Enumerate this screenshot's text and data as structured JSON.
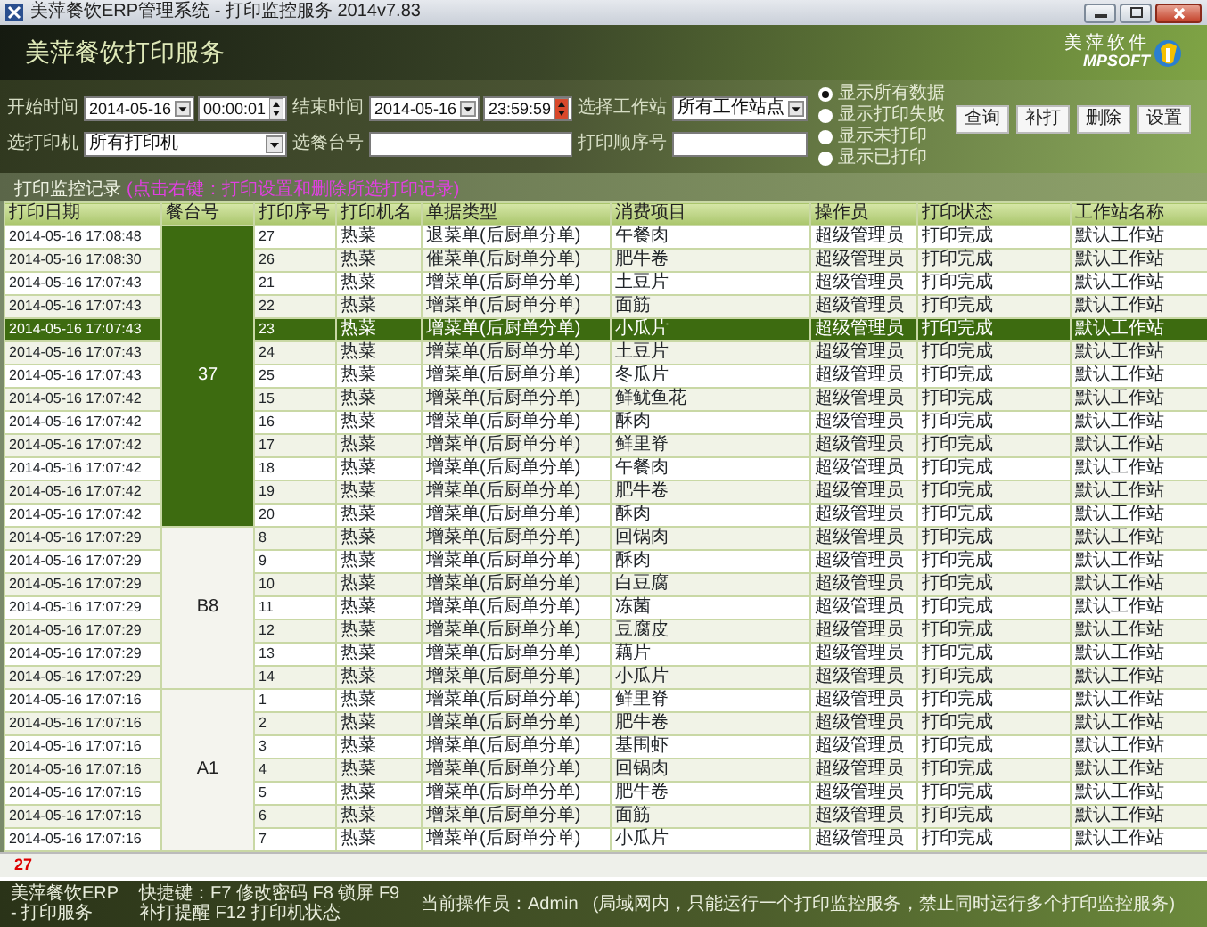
{
  "window": {
    "title": "美萍餐饮ERP管理系统 - 打印监控服务 2014v7.83"
  },
  "banner": {
    "title": "美萍餐饮打印服务",
    "logo_text": "美萍软件",
    "logo_subtext": "MPSOFT"
  },
  "filters": {
    "start_label": "开始时间",
    "start_date": "2014-05-16",
    "start_time": "00:00:01",
    "end_label": "结束时间",
    "end_date": "2014-05-16",
    "end_time": "23:59:59",
    "station_label": "选择工作站",
    "station_value": "所有工作站点",
    "printer_label": "选打印机",
    "printer_value": "所有打印机",
    "table_no_label": "选餐台号",
    "print_no_label": "打印顺序号"
  },
  "view_options": [
    {
      "label": "显示所有数据",
      "selected": true
    },
    {
      "label": "显示打印失败",
      "selected": false
    },
    {
      "label": "显示未打印",
      "selected": false
    },
    {
      "label": "显示已打印",
      "selected": false
    }
  ],
  "buttons": [
    "查询",
    "补打",
    "删除",
    "设置"
  ],
  "records": {
    "caption": "打印监控记录",
    "hint": "(点击右键：打印设置和删除所选打印记录)",
    "columns": [
      "打印日期",
      "餐台号",
      "打印序号",
      "打印机名",
      "单据类型",
      "消费项目",
      "操作员",
      "打印状态",
      "工作站名称"
    ],
    "groups": [
      {
        "table": "37",
        "selected": true,
        "rows": [
          {
            "date": "2014-05-16 17:08:48",
            "no": "27",
            "printer": "热菜",
            "type": "退菜单(后厨单分单)",
            "item": "午餐肉",
            "operator": "超级管理员",
            "status": "打印完成",
            "station": "默认工作站",
            "selected": false
          },
          {
            "date": "2014-05-16 17:08:30",
            "no": "26",
            "printer": "热菜",
            "type": "催菜单(后厨单分单)",
            "item": "肥牛卷",
            "operator": "超级管理员",
            "status": "打印完成",
            "station": "默认工作站",
            "selected": false
          },
          {
            "date": "2014-05-16 17:07:43",
            "no": "21",
            "printer": "热菜",
            "type": "增菜单(后厨单分单)",
            "item": "土豆片",
            "operator": "超级管理员",
            "status": "打印完成",
            "station": "默认工作站",
            "selected": false
          },
          {
            "date": "2014-05-16 17:07:43",
            "no": "22",
            "printer": "热菜",
            "type": "增菜单(后厨单分单)",
            "item": "面筋",
            "operator": "超级管理员",
            "status": "打印完成",
            "station": "默认工作站",
            "selected": false
          },
          {
            "date": "2014-05-16 17:07:43",
            "no": "23",
            "printer": "热菜",
            "type": "增菜单(后厨单分单)",
            "item": "小瓜片",
            "operator": "超级管理员",
            "status": "打印完成",
            "station": "默认工作站",
            "selected": true
          },
          {
            "date": "2014-05-16 17:07:43",
            "no": "24",
            "printer": "热菜",
            "type": "增菜单(后厨单分单)",
            "item": "土豆片",
            "operator": "超级管理员",
            "status": "打印完成",
            "station": "默认工作站",
            "selected": false
          },
          {
            "date": "2014-05-16 17:07:43",
            "no": "25",
            "printer": "热菜",
            "type": "增菜单(后厨单分单)",
            "item": "冬瓜片",
            "operator": "超级管理员",
            "status": "打印完成",
            "station": "默认工作站",
            "selected": false
          },
          {
            "date": "2014-05-16 17:07:42",
            "no": "15",
            "printer": "热菜",
            "type": "增菜单(后厨单分单)",
            "item": "鲜鱿鱼花",
            "operator": "超级管理员",
            "status": "打印完成",
            "station": "默认工作站",
            "selected": false
          },
          {
            "date": "2014-05-16 17:07:42",
            "no": "16",
            "printer": "热菜",
            "type": "增菜单(后厨单分单)",
            "item": "酥肉",
            "operator": "超级管理员",
            "status": "打印完成",
            "station": "默认工作站",
            "selected": false
          },
          {
            "date": "2014-05-16 17:07:42",
            "no": "17",
            "printer": "热菜",
            "type": "增菜单(后厨单分单)",
            "item": "鲜里脊",
            "operator": "超级管理员",
            "status": "打印完成",
            "station": "默认工作站",
            "selected": false
          },
          {
            "date": "2014-05-16 17:07:42",
            "no": "18",
            "printer": "热菜",
            "type": "增菜单(后厨单分单)",
            "item": "午餐肉",
            "operator": "超级管理员",
            "status": "打印完成",
            "station": "默认工作站",
            "selected": false
          },
          {
            "date": "2014-05-16 17:07:42",
            "no": "19",
            "printer": "热菜",
            "type": "增菜单(后厨单分单)",
            "item": "肥牛卷",
            "operator": "超级管理员",
            "status": "打印完成",
            "station": "默认工作站",
            "selected": false
          },
          {
            "date": "2014-05-16 17:07:42",
            "no": "20",
            "printer": "热菜",
            "type": "增菜单(后厨单分单)",
            "item": "酥肉",
            "operator": "超级管理员",
            "status": "打印完成",
            "station": "默认工作站",
            "selected": false
          }
        ]
      },
      {
        "table": "B8",
        "selected": false,
        "rows": [
          {
            "date": "2014-05-16 17:07:29",
            "no": "8",
            "printer": "热菜",
            "type": "增菜单(后厨单分单)",
            "item": "回锅肉",
            "operator": "超级管理员",
            "status": "打印完成",
            "station": "默认工作站",
            "selected": false
          },
          {
            "date": "2014-05-16 17:07:29",
            "no": "9",
            "printer": "热菜",
            "type": "增菜单(后厨单分单)",
            "item": "酥肉",
            "operator": "超级管理员",
            "status": "打印完成",
            "station": "默认工作站",
            "selected": false
          },
          {
            "date": "2014-05-16 17:07:29",
            "no": "10",
            "printer": "热菜",
            "type": "增菜单(后厨单分单)",
            "item": "白豆腐",
            "operator": "超级管理员",
            "status": "打印完成",
            "station": "默认工作站",
            "selected": false
          },
          {
            "date": "2014-05-16 17:07:29",
            "no": "11",
            "printer": "热菜",
            "type": "增菜单(后厨单分单)",
            "item": "冻菌",
            "operator": "超级管理员",
            "status": "打印完成",
            "station": "默认工作站",
            "selected": false
          },
          {
            "date": "2014-05-16 17:07:29",
            "no": "12",
            "printer": "热菜",
            "type": "增菜单(后厨单分单)",
            "item": "豆腐皮",
            "operator": "超级管理员",
            "status": "打印完成",
            "station": "默认工作站",
            "selected": false
          },
          {
            "date": "2014-05-16 17:07:29",
            "no": "13",
            "printer": "热菜",
            "type": "增菜单(后厨单分单)",
            "item": "藕片",
            "operator": "超级管理员",
            "status": "打印完成",
            "station": "默认工作站",
            "selected": false
          },
          {
            "date": "2014-05-16 17:07:29",
            "no": "14",
            "printer": "热菜",
            "type": "增菜单(后厨单分单)",
            "item": "小瓜片",
            "operator": "超级管理员",
            "status": "打印完成",
            "station": "默认工作站",
            "selected": false
          }
        ]
      },
      {
        "table": "A1",
        "selected": false,
        "rows": [
          {
            "date": "2014-05-16 17:07:16",
            "no": "1",
            "printer": "热菜",
            "type": "增菜单(后厨单分单)",
            "item": "鲜里脊",
            "operator": "超级管理员",
            "status": "打印完成",
            "station": "默认工作站",
            "selected": false
          },
          {
            "date": "2014-05-16 17:07:16",
            "no": "2",
            "printer": "热菜",
            "type": "增菜单(后厨单分单)",
            "item": "肥牛卷",
            "operator": "超级管理员",
            "status": "打印完成",
            "station": "默认工作站",
            "selected": false
          },
          {
            "date": "2014-05-16 17:07:16",
            "no": "3",
            "printer": "热菜",
            "type": "增菜单(后厨单分单)",
            "item": "基围虾",
            "operator": "超级管理员",
            "status": "打印完成",
            "station": "默认工作站",
            "selected": false
          },
          {
            "date": "2014-05-16 17:07:16",
            "no": "4",
            "printer": "热菜",
            "type": "增菜单(后厨单分单)",
            "item": "回锅肉",
            "operator": "超级管理员",
            "status": "打印完成",
            "station": "默认工作站",
            "selected": false
          },
          {
            "date": "2014-05-16 17:07:16",
            "no": "5",
            "printer": "热菜",
            "type": "增菜单(后厨单分单)",
            "item": "肥牛卷",
            "operator": "超级管理员",
            "status": "打印完成",
            "station": "默认工作站",
            "selected": false
          },
          {
            "date": "2014-05-16 17:07:16",
            "no": "6",
            "printer": "热菜",
            "type": "增菜单(后厨单分单)",
            "item": "面筋",
            "operator": "超级管理员",
            "status": "打印完成",
            "station": "默认工作站",
            "selected": false
          },
          {
            "date": "2014-05-16 17:07:16",
            "no": "7",
            "printer": "热菜",
            "type": "增菜单(后厨单分单)",
            "item": "小瓜片",
            "operator": "超级管理员",
            "status": "打印完成",
            "station": "默认工作站",
            "selected": false
          }
        ]
      }
    ],
    "count": "27"
  },
  "status_bar": [
    "美萍餐饮ERP - 打印服务",
    "快捷键：F7 修改密码  F8 锁屏  F9 补打提醒  F12 打印机状态",
    "当前操作员：Admin",
    "(局域网内，只能运行一个打印监控服务，禁止同时运行多个打印监控服务)"
  ]
}
